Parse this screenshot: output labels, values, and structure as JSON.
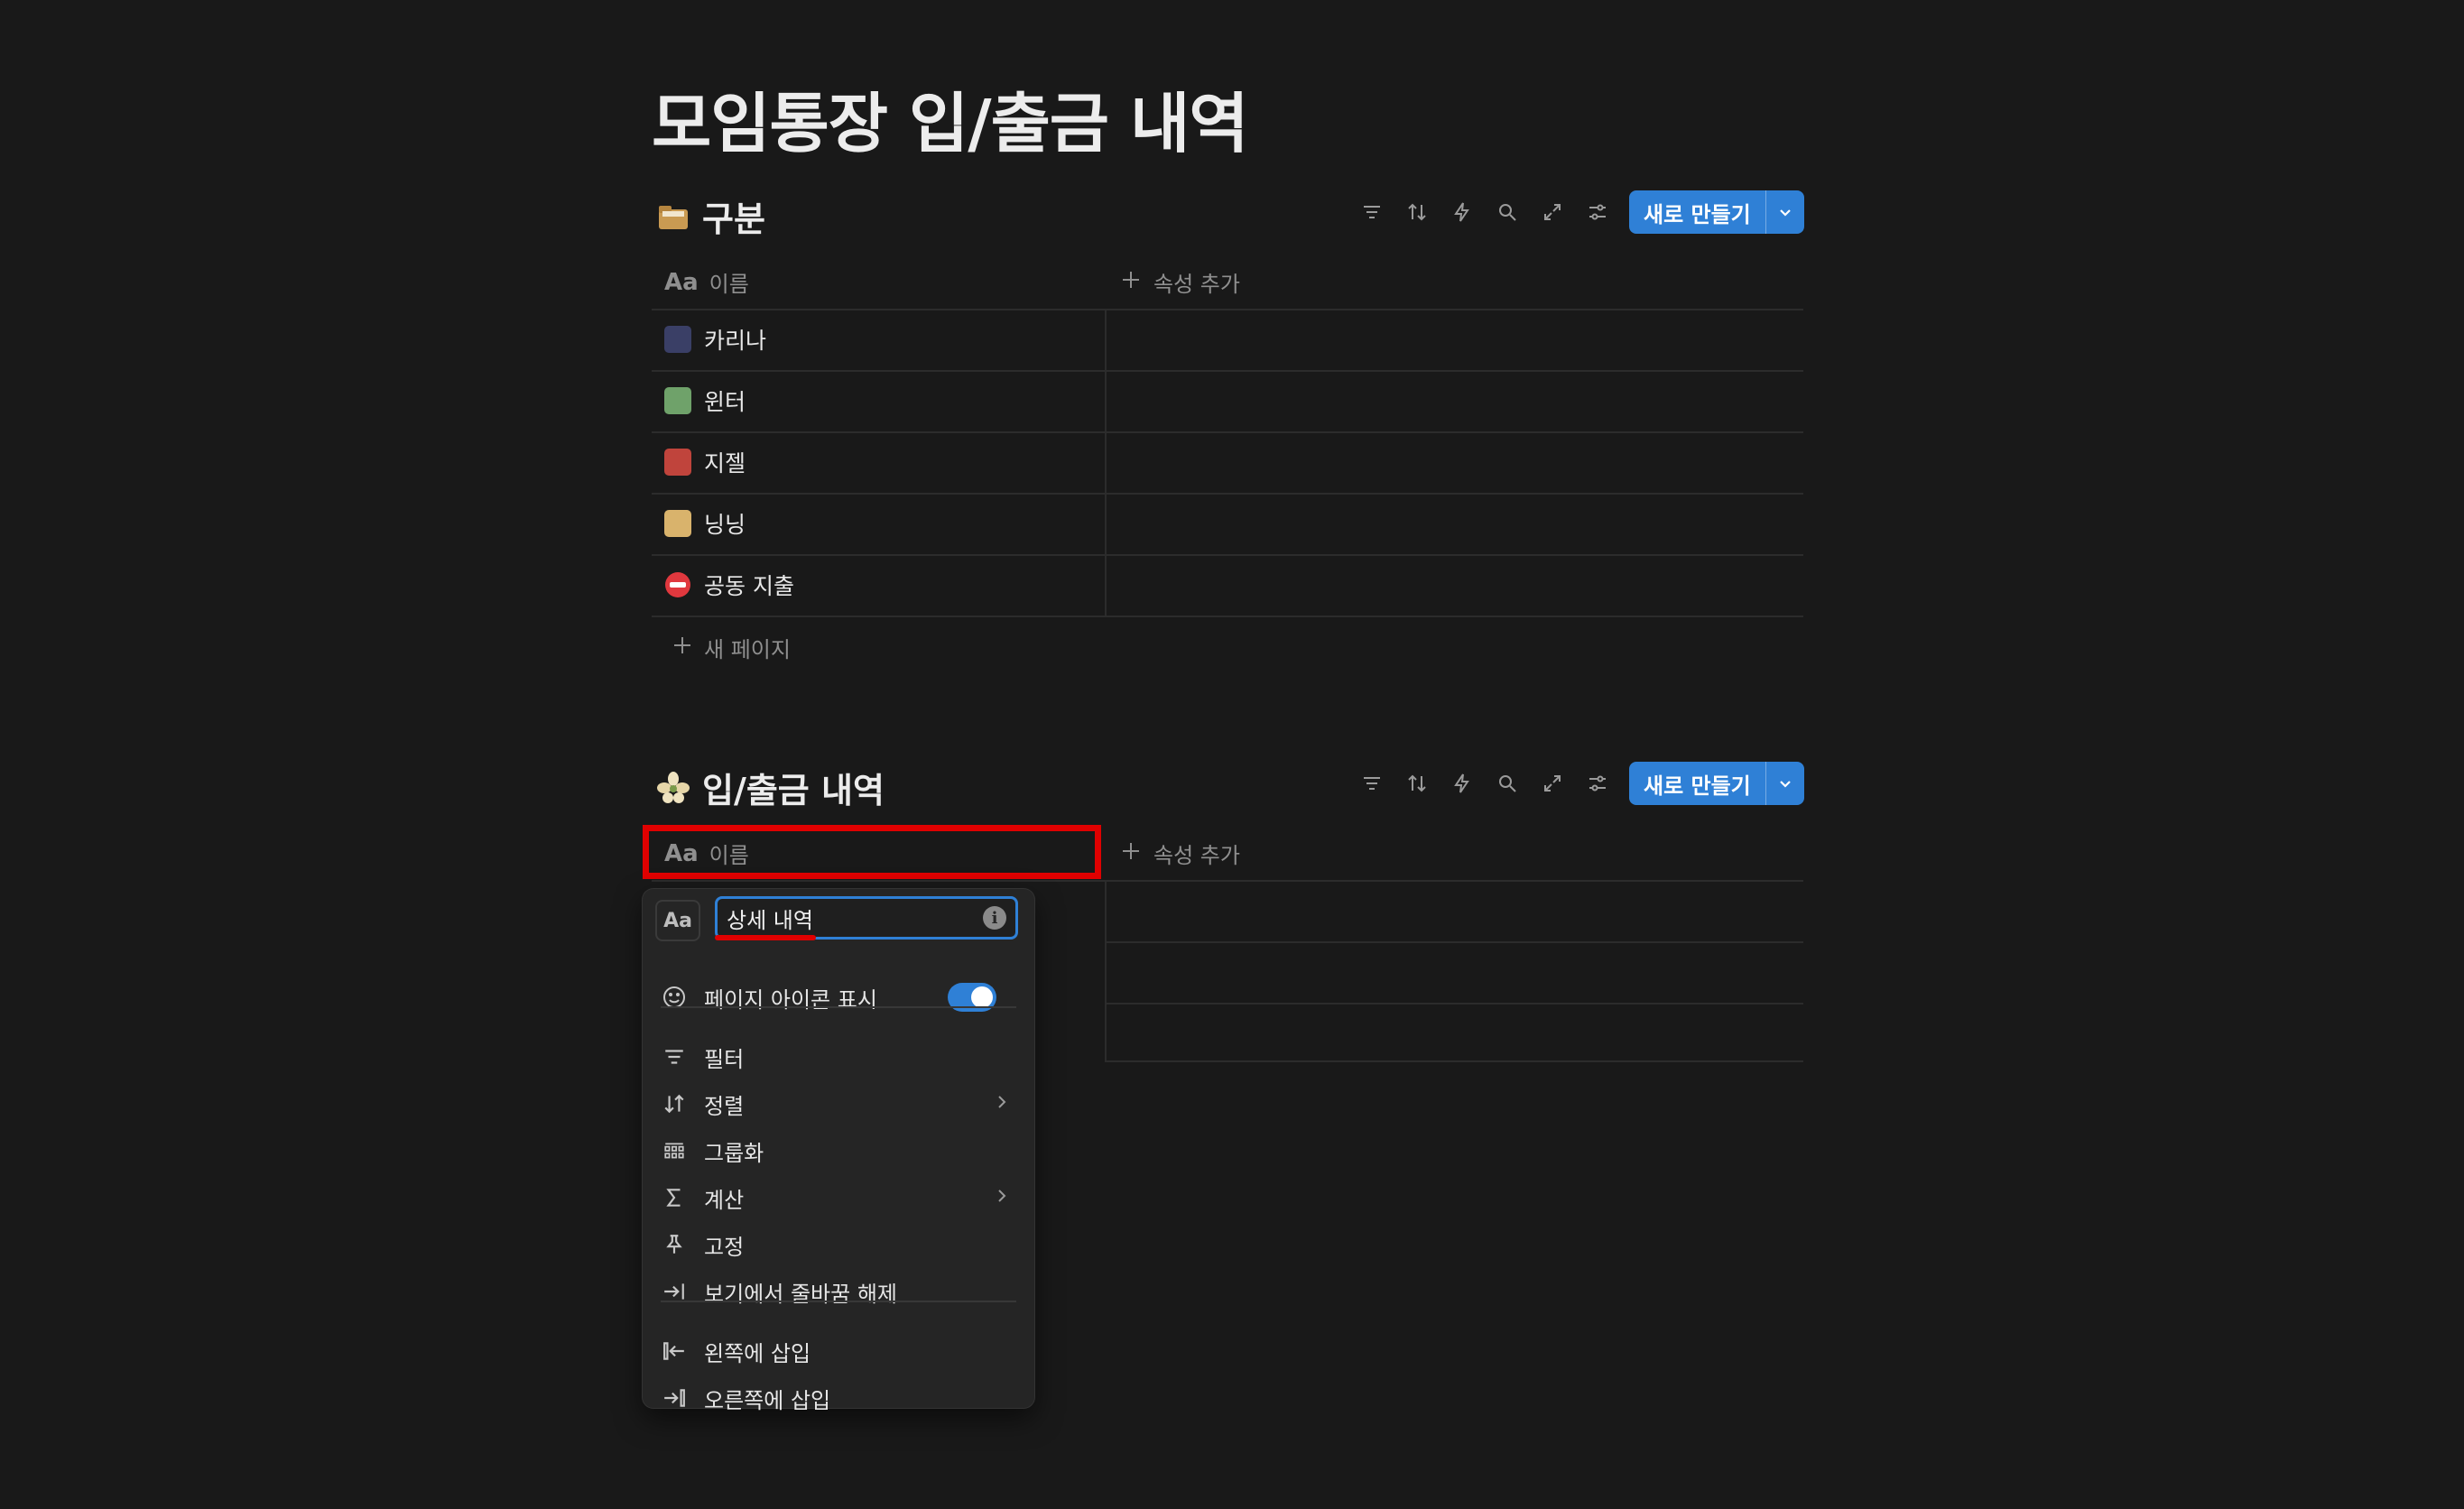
{
  "page": {
    "title": "모임통장 입/출금 내역"
  },
  "db1": {
    "title": "구분",
    "icon": "folder-icon",
    "new_label": "새로 만들기",
    "header_name": "이름",
    "header_add": "속성 추가",
    "rows": [
      {
        "label": "카리나",
        "icon": "avatar-karina",
        "color": "#3a3f66"
      },
      {
        "label": "윈터",
        "icon": "avatar-winter",
        "color": "#6fa26a"
      },
      {
        "label": "지젤",
        "icon": "avatar-giselle",
        "color": "#c0443c"
      },
      {
        "label": "닝닝",
        "icon": "avatar-ningning",
        "color": "#d9b36c"
      },
      {
        "label": "공동 지출",
        "icon": "no-entry-icon",
        "color": "#e0383e"
      }
    ],
    "new_page": "새 페이지"
  },
  "db2": {
    "title": "입/출금 내역",
    "icon": "flower-icon",
    "new_label": "새로 만들기",
    "header_name": "이름",
    "header_add": "속성 추가"
  },
  "menu": {
    "name_value": "상세 내역",
    "show_icon": "페이지 아이콘 표시",
    "show_icon_on": true,
    "items": {
      "filter": "필터",
      "sort": "정렬",
      "group": "그룹화",
      "calc": "계산",
      "pin": "고정",
      "unwrap": "보기에서 줄바꿈 해제",
      "insert_left": "왼쪽에 삽입",
      "insert_right": "오른쪽에 삽입"
    }
  },
  "colors": {
    "accent": "#2f80d6",
    "highlight": "#e00000",
    "background": "#191919"
  }
}
